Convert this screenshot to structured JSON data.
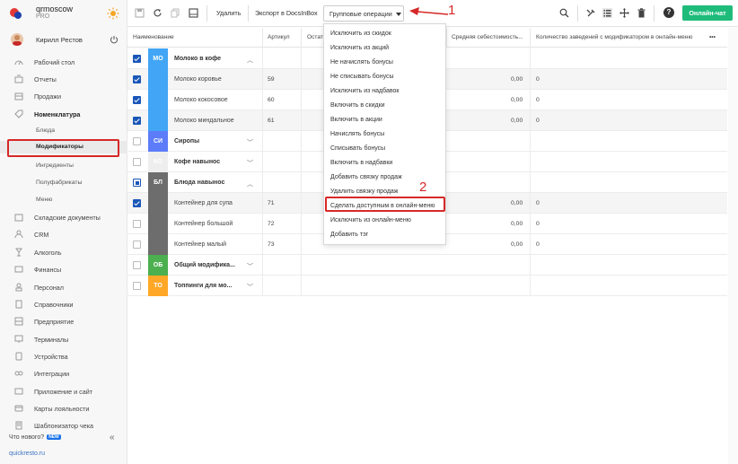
{
  "brand": {
    "name": "qrmoscow",
    "plan": "PRO"
  },
  "user": {
    "name": "Кирилл Рестов"
  },
  "sidebar": {
    "items": [
      {
        "label": "Рабочий стол",
        "icon": "dashboard-icon"
      },
      {
        "label": "Отчеты",
        "icon": "reports-icon"
      },
      {
        "label": "Продажи",
        "icon": "sales-icon"
      },
      {
        "label": "Номенклатура",
        "icon": "tag-icon"
      }
    ],
    "subitems": [
      {
        "label": "Блюда"
      },
      {
        "label": "Модификаторы"
      },
      {
        "label": "Ингредиенты"
      },
      {
        "label": "Полуфабрикаты"
      },
      {
        "label": "Меню"
      }
    ],
    "items2": [
      {
        "label": "Складские документы",
        "icon": "warehouse-icon"
      },
      {
        "label": "CRM",
        "icon": "crm-icon"
      },
      {
        "label": "Алкоголь",
        "icon": "alcohol-icon"
      },
      {
        "label": "Финансы",
        "icon": "finance-icon"
      },
      {
        "label": "Персонал",
        "icon": "staff-icon"
      },
      {
        "label": "Справочники",
        "icon": "directory-icon"
      },
      {
        "label": "Предприятие",
        "icon": "enterprise-icon"
      },
      {
        "label": "Терминалы",
        "icon": "terminal-icon"
      },
      {
        "label": "Устройства",
        "icon": "device-icon"
      },
      {
        "label": "Интеграции",
        "icon": "integration-icon"
      },
      {
        "label": "Приложение и сайт",
        "icon": "app-icon"
      },
      {
        "label": "Карты лояльности",
        "icon": "card-icon"
      },
      {
        "label": "Шаблонизатор чека",
        "icon": "receipt-icon"
      }
    ],
    "whatsnew": "Что нового?",
    "new_badge": "NEW",
    "site": "quickresto.ru"
  },
  "toolbar": {
    "delete": "Удалить",
    "export": "Экспорт в DocsInBox",
    "group_ops": "Групповые операции",
    "online_chat": "Онлайн-чат",
    "help": "?"
  },
  "annotations": {
    "one": "1",
    "two": "2"
  },
  "table": {
    "headers": {
      "name": "Наименование",
      "article": "Артикул",
      "rest": "Остат",
      "avg_cost": "Средняя себестоимость...",
      "count": "Количество заведений с модификатором в онлайн-меню",
      "more": "•••"
    },
    "rows": [
      {
        "type": "cat",
        "badge": "МО",
        "name": "Молоко в кофе",
        "checked": "on",
        "color": "#42a5f5",
        "open": true
      },
      {
        "type": "item",
        "name": "Молоко коровье",
        "article": "59",
        "cost": "0,00",
        "count": "0",
        "checked": "on"
      },
      {
        "type": "item",
        "name": "Молоко кокосовое",
        "article": "60",
        "cost": "0,00",
        "count": "0",
        "checked": "on"
      },
      {
        "type": "item",
        "name": "Молоко миндальное",
        "article": "61",
        "cost": "0,00",
        "count": "0",
        "checked": "on"
      },
      {
        "type": "cat",
        "badge": "СИ",
        "name": "Сиропы",
        "checked": "off",
        "color": "#5c7cfa",
        "open": false
      },
      {
        "type": "cat",
        "badge": "КО",
        "name": "Кофе навынос",
        "checked": "off",
        "color": "#eeeeee",
        "open": false
      },
      {
        "type": "cat",
        "badge": "БЛ",
        "name": "Блюда навынос",
        "checked": "part",
        "color": "#6d6d6d",
        "open": true
      },
      {
        "type": "item",
        "name": "Контейнер для супа",
        "article": "71",
        "cost": "0,00",
        "count": "0",
        "checked": "on"
      },
      {
        "type": "item",
        "name": "Контейнер большой",
        "article": "72",
        "cost": "0,00",
        "count": "0",
        "checked": "off"
      },
      {
        "type": "item",
        "name": "Контейнер малый",
        "article": "73",
        "cost": "0,00",
        "count": "0",
        "checked": "off"
      },
      {
        "type": "cat",
        "badge": "ОБ",
        "name": "Общий модифика...",
        "checked": "off",
        "color": "#4caf50",
        "open": false
      },
      {
        "type": "cat",
        "badge": "ТО",
        "name": "Топпинги для мо...",
        "checked": "off",
        "color": "#ffa726",
        "open": false
      }
    ]
  },
  "dropdown": {
    "items": [
      "Исключить из скидок",
      "Исключить из акций",
      "Не начислять бонусы",
      "Не списывать бонусы",
      "Исключить из надбавок",
      "Включить в скидки",
      "Включить в акции",
      "Начислять бонусы",
      "Списывать бонусы",
      "Включить в надбавки",
      "Добавить связку продаж",
      "Удалить связку продаж",
      "Сделать доступным в онлайн-меню",
      "Исключить из онлайн-меню",
      "Добавить тэг"
    ]
  },
  "colors": {
    "accent": "#1ebb7a",
    "highlight": "#d62828",
    "checkbox": "#1a56b7"
  }
}
